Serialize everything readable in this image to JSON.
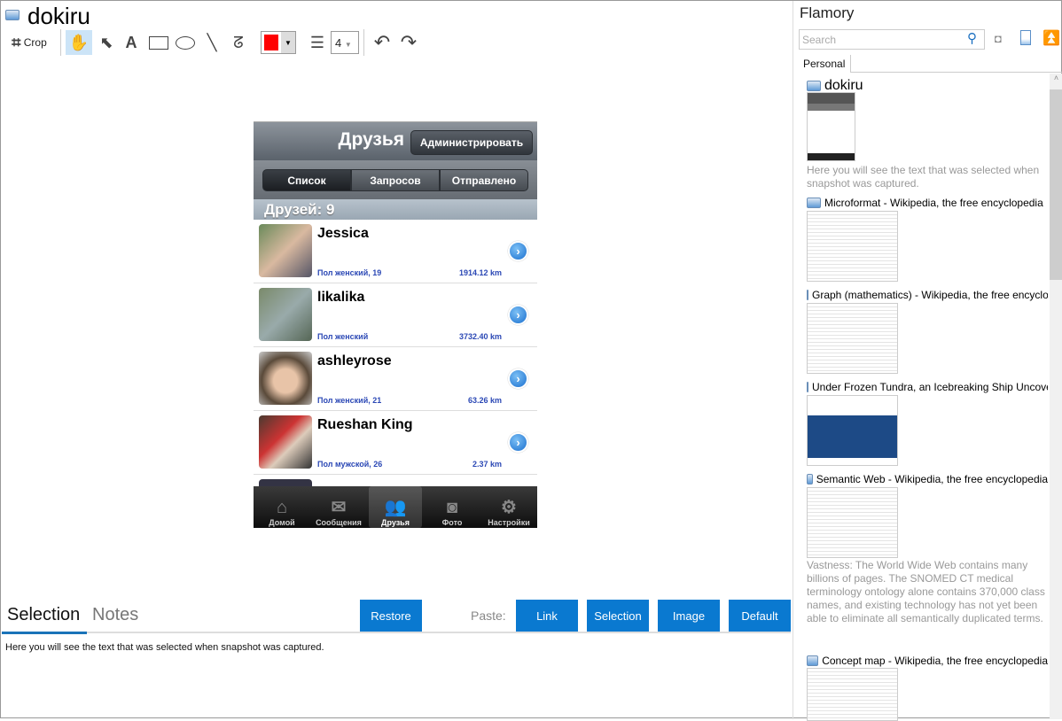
{
  "header": {
    "title": "dokiru"
  },
  "toolbar": {
    "crop_label": "Crop",
    "line_width": "4",
    "color": "#ff0000"
  },
  "phone": {
    "nav_title": "Друзья",
    "admin_button": "Администрировать",
    "segments": [
      "Список",
      "Запросов",
      "Отправлено"
    ],
    "section_header": "Друзей: 9",
    "friends": [
      {
        "name": "Jessica",
        "info": "Пол женский, 19",
        "distance": "1914.12 km"
      },
      {
        "name": "likalika",
        "info": "Пол женский",
        "distance": "3732.40 km"
      },
      {
        "name": "ashleyrose",
        "info": "Пол женский, 21",
        "distance": "63.26 km"
      },
      {
        "name": "Rueshan King",
        "info": "Пол мужской, 26",
        "distance": "2.37 km"
      }
    ],
    "tabs": [
      "Домой",
      "Сообщения",
      "Друзья",
      "Фото",
      "Настройки"
    ]
  },
  "bottom": {
    "tabs": [
      "Selection",
      "Notes"
    ],
    "restore": "Restore",
    "paste_label": "Paste:",
    "paste_buttons": [
      "Link",
      "Selection",
      "Image",
      "Default"
    ],
    "selection_text": "Here you will see the text that was selected when snapshot was captured."
  },
  "right": {
    "title": "Flamory",
    "search_placeholder": "Search",
    "tab": "Personal",
    "items": [
      {
        "title": "dokiru",
        "desc": "Here you will see the text that was selected when snapshot was captured."
      },
      {
        "title": "Microformat - Wikipedia, the free encyclopedia"
      },
      {
        "title": "Graph (mathematics) - Wikipedia, the free encyclopedia"
      },
      {
        "title": "Under Frozen Tundra, an Icebreaking Ship Uncovers"
      },
      {
        "title": "Semantic Web - Wikipedia, the free encyclopedia",
        "desc": "Vastness: The World Wide Web contains many billions of pages. The SNOMED CT medical terminology ontology alone contains 370,000 class names, and existing technology has not yet been able to eliminate all semantically duplicated terms. Any automated reasoning system will have to deal with truly huge inputs."
      },
      {
        "title": "Concept map - Wikipedia, the free encyclopedia"
      }
    ]
  }
}
